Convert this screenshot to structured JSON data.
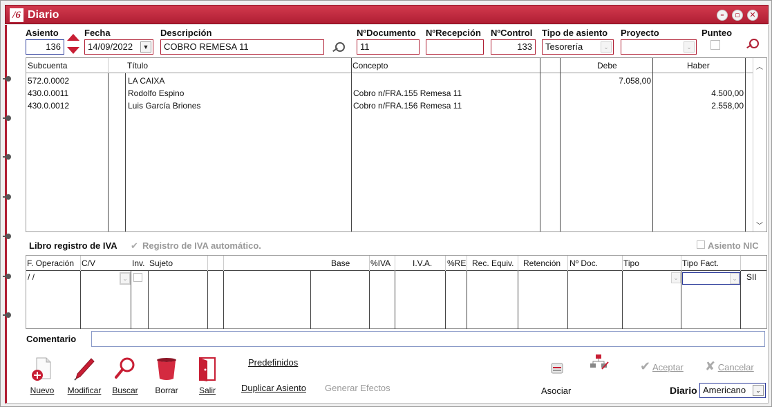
{
  "window": {
    "title": "Diario",
    "logo": "/6",
    "controls": [
      "minimize-icon",
      "restore-icon",
      "close-icon"
    ]
  },
  "header": {
    "asiento_label": "Asiento",
    "asiento_value": "136",
    "fecha_label": "Fecha",
    "fecha_value": "14/09/2022",
    "descripcion_label": "Descripción",
    "descripcion_value": "COBRO REMESA 11",
    "ndocumento_label": "NºDocumento",
    "ndocumento_value": "11",
    "nrecepcion_label": "NºRecepción",
    "nrecepcion_value": "",
    "ncontrol_label": "NºControl",
    "ncontrol_value": "133",
    "tipo_label": "Tipo de asiento",
    "tipo_value": "Tesorería",
    "proyecto_label": "Proyecto",
    "proyecto_value": "",
    "punteo_label": "Punteo"
  },
  "grid": {
    "columns": [
      "Subcuenta",
      "Título",
      "Concepto",
      "Debe",
      "Haber"
    ],
    "rows": [
      {
        "subcuenta": "572.0.0002",
        "titulo": "LA CAIXA",
        "concepto": "",
        "debe": "7.058,00",
        "haber": ""
      },
      {
        "subcuenta": "430.0.0011",
        "titulo": "Rodolfo Espino",
        "concepto": "Cobro n/FRA.155 Remesa 11",
        "debe": "",
        "haber": "4.500,00"
      },
      {
        "subcuenta": "430.0.0012",
        "titulo": "Luis García Briones",
        "concepto": "Cobro n/FRA.156 Remesa 11",
        "debe": "",
        "haber": "2.558,00"
      }
    ]
  },
  "iva": {
    "libro_label": "Libro registro de IVA",
    "auto_label": "Registro de IVA automático.",
    "nic_label": "Asiento NIC",
    "columns": [
      "F. Operación",
      "C/V",
      "Inv.",
      "Sujeto",
      "Base",
      "%IVA",
      "I.V.A.",
      "%RE",
      "Rec. Equiv.",
      "Retención",
      "Nº Doc.",
      "Tipo",
      "Tipo Fact."
    ],
    "row": {
      "fecha": " /  /",
      "sii": "SII"
    }
  },
  "comentario": {
    "label": "Comentario",
    "value": ""
  },
  "toolbar": {
    "nuevo": "Nuevo",
    "modificar": "Modificar",
    "buscar": "Buscar",
    "borrar": "Borrar",
    "salir": "Salir",
    "predefinidos": "Predefinidos",
    "duplicar": "Duplicar Asiento",
    "generar": "Generar Efectos",
    "asociar": "Asociar",
    "aceptar": "Aceptar",
    "cancelar": "Cancelar",
    "diario_label": "Diario",
    "diario_value": "Americano"
  },
  "colors": {
    "accent": "#b01e33",
    "focus": "#2b3a9a"
  }
}
